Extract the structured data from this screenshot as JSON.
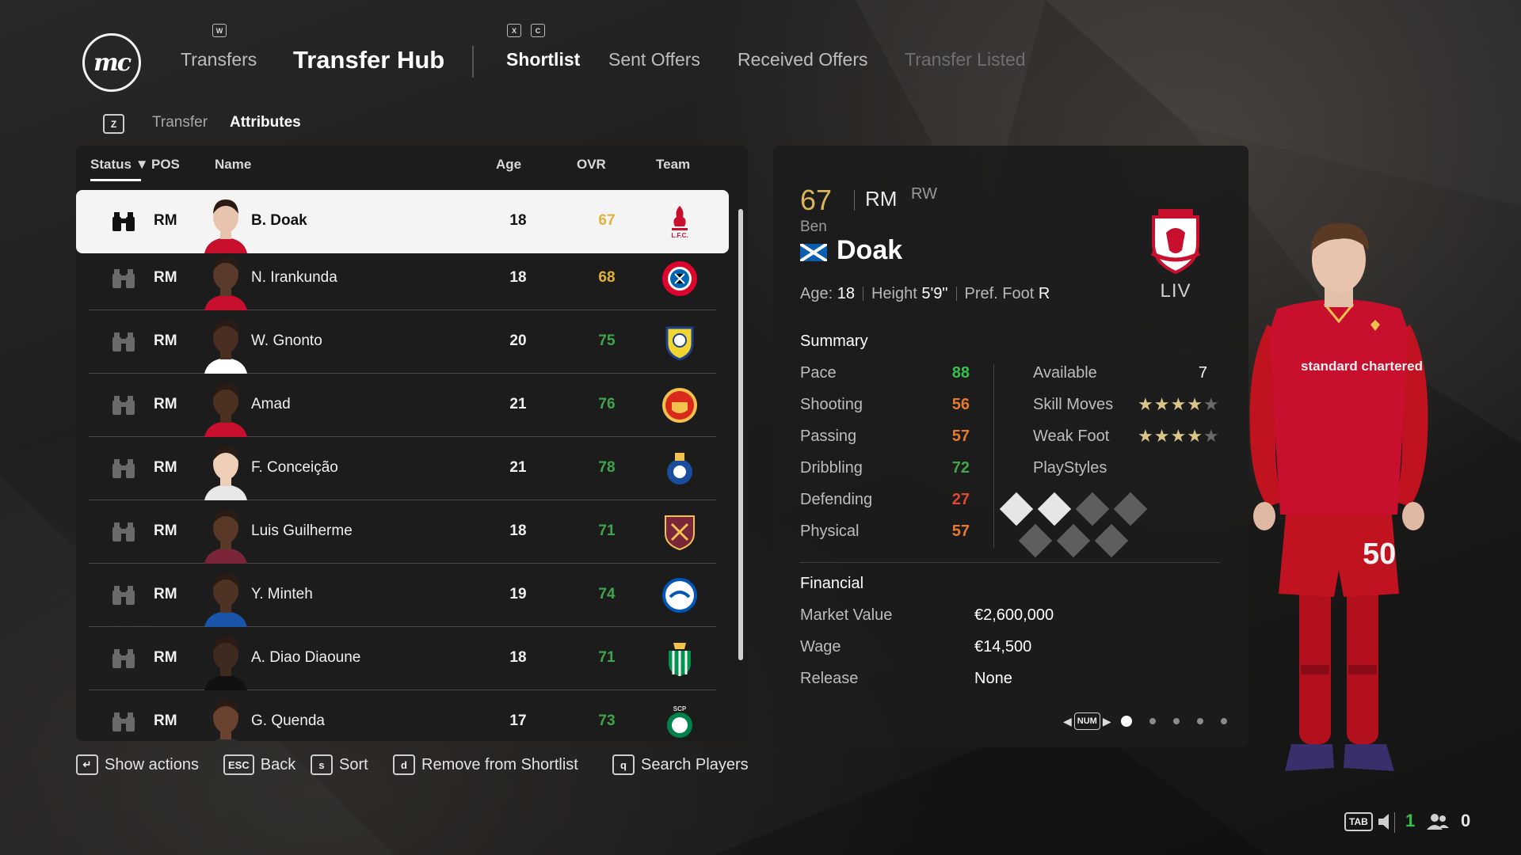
{
  "header": {
    "logo_text": "mc",
    "nav_key_hub": "W",
    "nav_key_left": "X",
    "nav_key_right": "C",
    "nav_transfers": "Transfers",
    "nav_hub": "Transfer Hub",
    "tabs": {
      "shortlist": "Shortlist",
      "sent_offers": "Sent Offers",
      "received_offers": "Received Offers",
      "transfer_listed": "Transfer Listed"
    }
  },
  "subtabs": {
    "key": "Z",
    "transfer": "Transfer",
    "attributes": "Attributes"
  },
  "list": {
    "columns": {
      "status": "Status",
      "pos": "POS",
      "name": "Name",
      "age": "Age",
      "ovr": "OVR",
      "team": "Team"
    },
    "rows": [
      {
        "pos": "RM",
        "name": "B. Doak",
        "age": "18",
        "ovr": "67",
        "ovr_color": "#e0b23a",
        "team": "liverpool-crest",
        "selected": true
      },
      {
        "pos": "RM",
        "name": "N. Irankunda",
        "age": "18",
        "ovr": "68",
        "ovr_color": "#e0b23a",
        "team": "bayern-munich-crest"
      },
      {
        "pos": "RM",
        "name": "W. Gnonto",
        "age": "20",
        "ovr": "75",
        "ovr_color": "#3fa64a",
        "team": "leeds-united-crest"
      },
      {
        "pos": "RM",
        "name": "Amad",
        "age": "21",
        "ovr": "76",
        "ovr_color": "#3fa64a",
        "team": "manchester-united-crest"
      },
      {
        "pos": "RM",
        "name": "F. Conceição",
        "age": "21",
        "ovr": "78",
        "ovr_color": "#3fa64a",
        "team": "fc-porto-crest"
      },
      {
        "pos": "RM",
        "name": "Luis Guilherme",
        "age": "18",
        "ovr": "71",
        "ovr_color": "#3fa64a",
        "team": "west-ham-crest"
      },
      {
        "pos": "RM",
        "name": "Y. Minteh",
        "age": "19",
        "ovr": "74",
        "ovr_color": "#3fa64a",
        "team": "brighton-crest"
      },
      {
        "pos": "RM",
        "name": "A. Diao Diaoune",
        "age": "18",
        "ovr": "71",
        "ovr_color": "#3fa64a",
        "team": "real-betis-crest"
      },
      {
        "pos": "RM",
        "name": "G. Quenda",
        "age": "17",
        "ovr": "73",
        "ovr_color": "#3fa64a",
        "team": "sporting-cp-crest"
      }
    ]
  },
  "actions": [
    {
      "key": "↵",
      "label": "Show actions"
    },
    {
      "key": "ESC",
      "label": "Back"
    },
    {
      "key": "s",
      "label": "Sort"
    },
    {
      "key": "d",
      "label": "Remove from Shortlist"
    },
    {
      "key": "q",
      "label": "Search Players"
    }
  ],
  "player": {
    "ovr": "67",
    "position": "RM",
    "alt_position": "RW",
    "first_name": "Ben",
    "last_name": "Doak",
    "team_abbr": "LIV",
    "age_label": "Age:",
    "age": "18",
    "height_label": "Height",
    "height": "5'9\"",
    "foot_label": "Pref. Foot",
    "foot": "R",
    "summary_title": "Summary",
    "attributes": [
      {
        "label": "Pace",
        "value": "88",
        "color": "#35c24a"
      },
      {
        "label": "Shooting",
        "value": "56",
        "color": "#e8792e"
      },
      {
        "label": "Passing",
        "value": "57",
        "color": "#e8792e"
      },
      {
        "label": "Dribbling",
        "value": "72",
        "color": "#3fa64a"
      },
      {
        "label": "Defending",
        "value": "27",
        "color": "#e0492e"
      },
      {
        "label": "Physical",
        "value": "57",
        "color": "#e8792e"
      }
    ],
    "available_label": "Available",
    "available": "7",
    "skill_moves_label": "Skill Moves",
    "skill_moves": 4,
    "weak_foot_label": "Weak Foot",
    "weak_foot": 4,
    "playstyles_label": "PlayStyles",
    "playstyles_filled": 2,
    "playstyles_total": 7,
    "financial_title": "Financial",
    "market_value_label": "Market Value",
    "market_value": "€2,600,000",
    "wage_label": "Wage",
    "wage": "€14,500",
    "release_label": "Release",
    "release": "None",
    "pager_key": "NUM",
    "page_current": 1,
    "page_total": 5,
    "shirt_number": "50",
    "sponsor": "standard chartered"
  },
  "status_bar": {
    "tab_key": "TAB",
    "count_green": "1",
    "count_people": "0"
  },
  "colors": {
    "ovr_gold": "#d9b45a",
    "green": "#3fa64a",
    "liverpool_red": "#c8102e"
  }
}
